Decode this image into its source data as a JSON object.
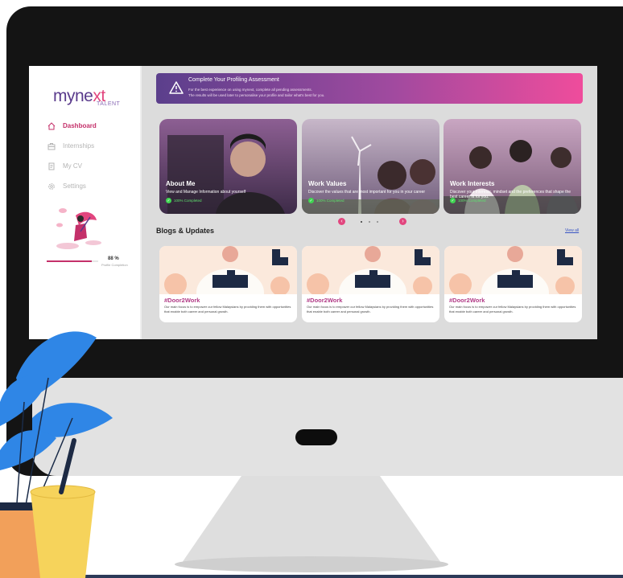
{
  "brand": {
    "logo_text": "myne",
    "logo_x": "xt",
    "logo_sub": "TALENT",
    "accent": "#c4306a",
    "purple": "#5a3b8c"
  },
  "sidebar": {
    "items": [
      {
        "label": "Dashboard",
        "icon": "home-icon",
        "active": true
      },
      {
        "label": "Internships",
        "icon": "briefcase-icon",
        "active": false
      },
      {
        "label": "My CV",
        "icon": "document-icon",
        "active": false
      },
      {
        "label": "Settings",
        "icon": "gear-icon",
        "active": false
      }
    ],
    "profile_progress": {
      "percent_text": "88 %",
      "label": "Profile Completion",
      "value": 0.88
    }
  },
  "banner": {
    "title": "Complete Your Profiling Assessment",
    "text_line1": "For the best experience on using mynext, complete all pending assessments.",
    "text_line2": "The results will be used later to personalise your profile and tailor what's best for you."
  },
  "cards": [
    {
      "title": "About Me",
      "desc": "View and Manage Information about yourself",
      "status": "100% Completed"
    },
    {
      "title": "Work Values",
      "desc": "Discover the values that are most important for you in your career",
      "status": "100% Completed"
    },
    {
      "title": "Work Interests",
      "desc": "Discover your interests, mindset and the preferences that shape the best career fit for you.",
      "status": "100% Completed"
    }
  ],
  "carousel": {
    "prev": "‹",
    "next": "›"
  },
  "blogs": {
    "title": "Blogs & Updates",
    "view_all": "View all",
    "items": [
      {
        "tag": "#Door2Work",
        "text": "Our main focus is to empower our fellow Malaysians by providing them with opportunities that enable both career and personal growth."
      },
      {
        "tag": "#Door2Work",
        "text": "Our main focus is to empower our fellow Malaysians by providing them with opportunities that enable both career and personal growth."
      },
      {
        "tag": "#Door2Work",
        "text": "Our main focus is to empower our fellow Malaysians by providing them with opportunities that enable both career and personal growth."
      }
    ]
  }
}
